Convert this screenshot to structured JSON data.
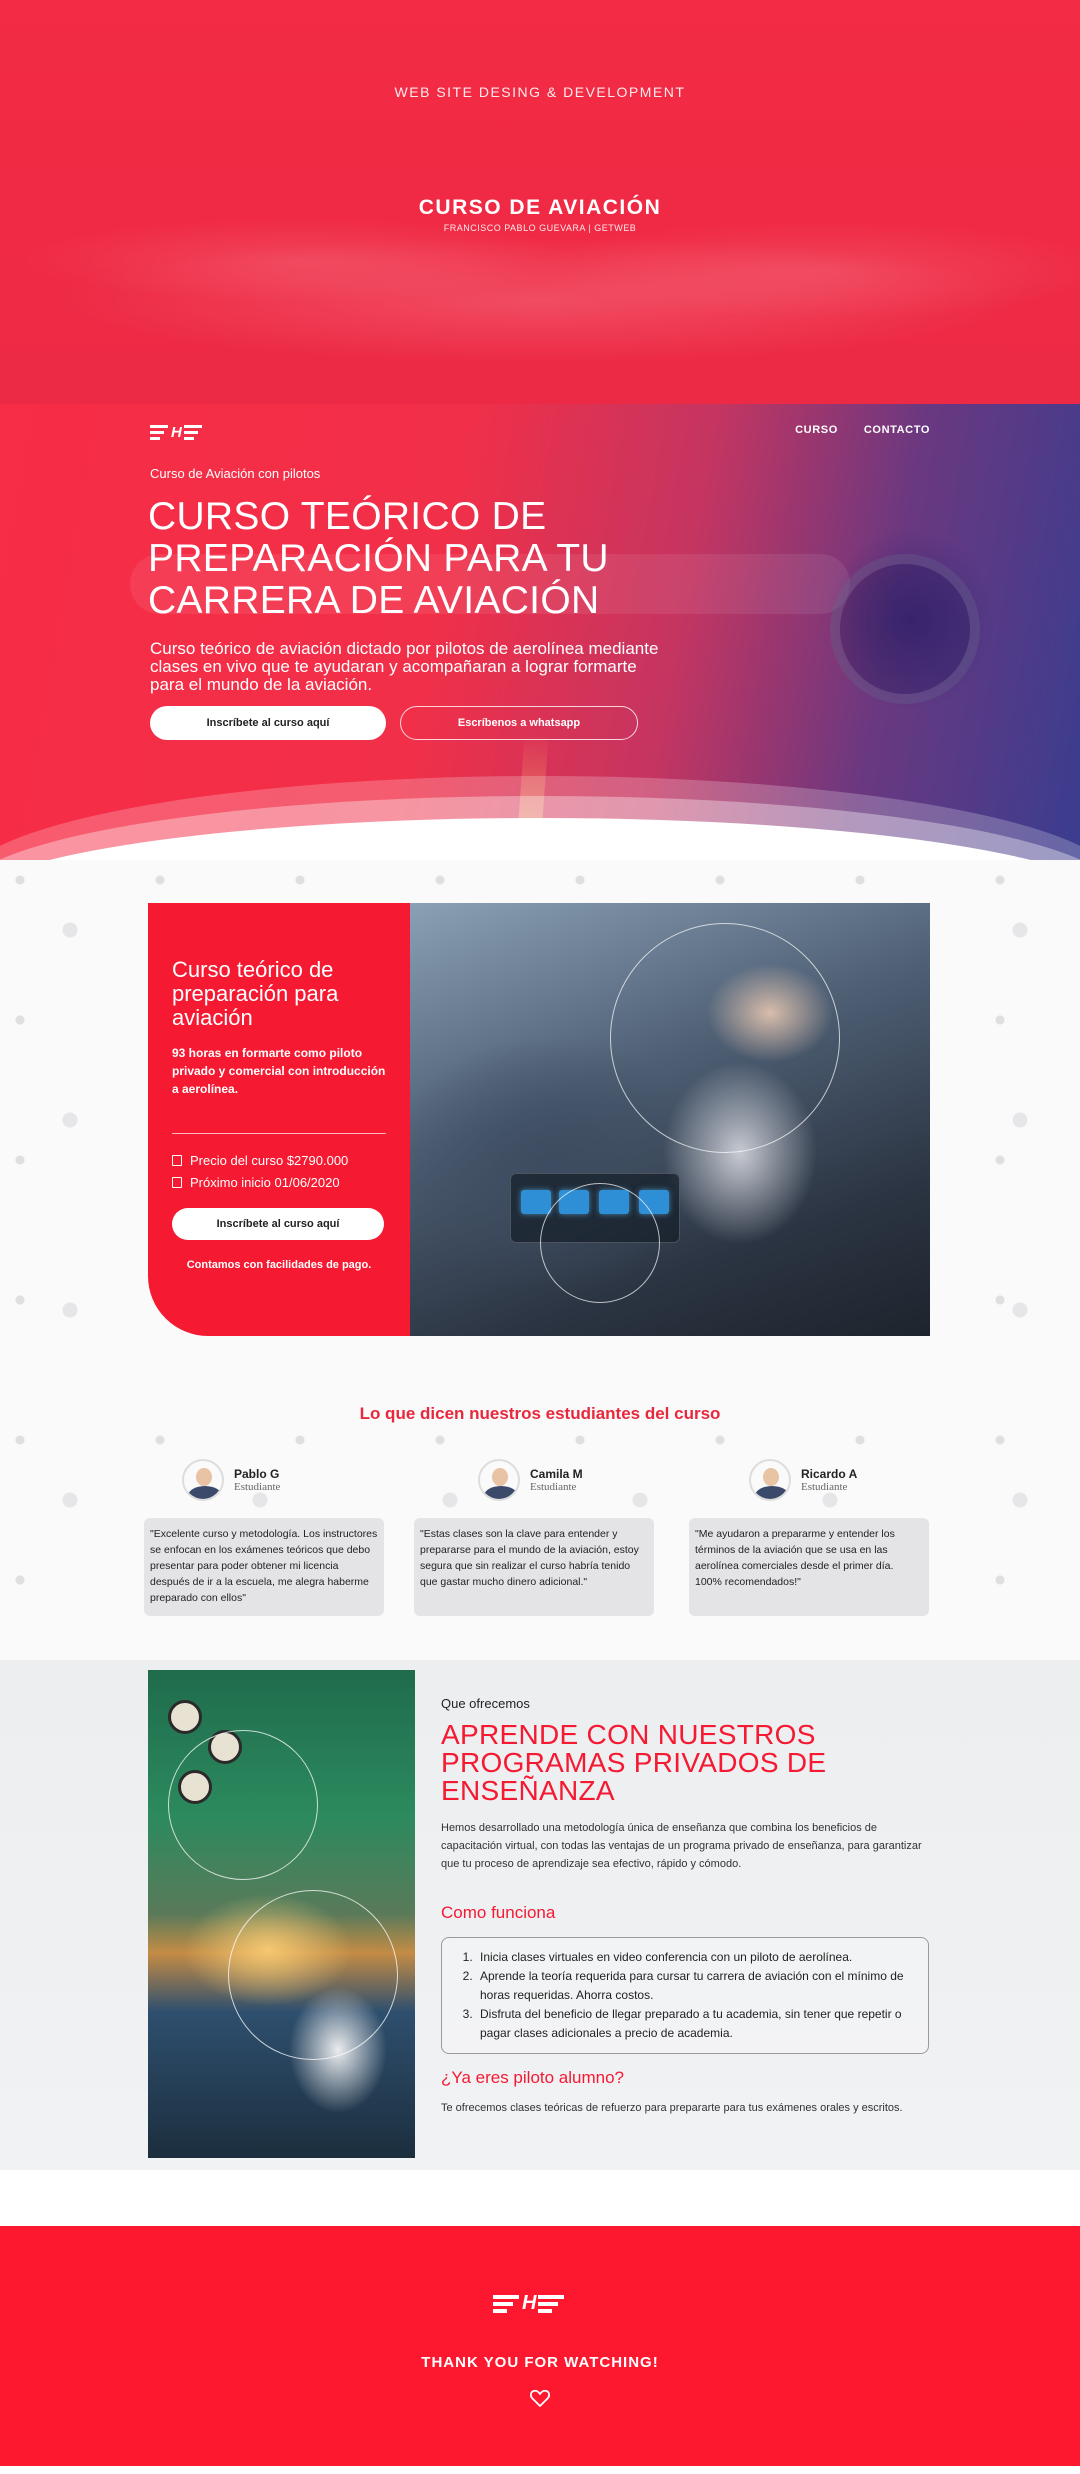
{
  "banner": {
    "kicker": "WEB SITE DESING & DEVELOPMENT",
    "title": "CURSO DE AVIACIÓN",
    "author": "FRANCISCO PABLO GUEVARA | GETWEB"
  },
  "nav": {
    "items": [
      {
        "label": "CURSO"
      },
      {
        "label": "CONTACTO"
      }
    ]
  },
  "hero": {
    "eyebrow": "Curso de Aviación con pilotos",
    "title": "CURSO TEÓRICO DE PREPARACIÓN PARA TU CARRERA DE AVIACIÓN",
    "lead": "Curso teórico de aviación dictado por pilotos de aerolínea mediante clases en vivo que te ayudaran y acompañaran a lograr formarte para el mundo de la aviación.",
    "primary_button": "Inscríbete al curso aquí",
    "secondary_button": "Escríbenos a whatsapp"
  },
  "course": {
    "title": "Curso teórico de preparación para aviación",
    "subtitle": "93 horas en formarte como piloto privado y comercial con introducción a aerolínea.",
    "price": "Precio del curso $2790.000",
    "start": "Próximo inicio 01/06/2020",
    "button": "Inscríbete al curso aquí",
    "payment_note": "Contamos con facilidades de pago."
  },
  "testimonials": {
    "title": "Lo que dicen nuestros estudiantes del curso",
    "items": [
      {
        "name": "Pablo G",
        "role": "Estudiante",
        "quote": "\"Excelente curso y metodología. Los instructores se enfocan en los exámenes teóricos que debo presentar para poder obtener mi licencia después de ir a la escuela, me alegra haberme preparado con ellos\""
      },
      {
        "name": "Camila M",
        "role": "Estudiante",
        "quote": "\"Estas clases son la clave para entender y prepararse para el mundo de la aviación, estoy segura que sin realizar el curso habría tenido que gastar mucho dinero adicional.\""
      },
      {
        "name": "Ricardo A",
        "role": "Estudiante",
        "quote": "\"Me ayudaron a prepararme y entender los términos de la aviación que se usa en las aerolínea comerciales desde el primer día. 100% recomendados!\""
      }
    ]
  },
  "offer": {
    "eyebrow": "Que ofrecemos",
    "title": "APRENDE CON NUESTROS PROGRAMAS PRIVADOS DE ENSEÑANZA",
    "description": "Hemos desarrollado una metodología única de enseñanza que combina los beneficios de capacitación virtual, con todas las ventajas de un programa privado de enseñanza, para garantizar que tu proceso de aprendizaje sea efectivo, rápido y cómodo.",
    "how_title": "Como funciona",
    "steps": [
      "Inicia clases virtuales en video conferencia con un piloto de aerolínea.",
      "Aprende la teoría requerida para cursar tu carrera de aviación con el mínimo de horas requeridas. Ahorra costos.",
      "Disfruta del beneficio de llegar preparado a tu academia, sin tener que repetir o pagar clases adicionales a precio de academia."
    ],
    "student_q": "¿Ya eres piloto alumno?",
    "student_text": "Te ofrecemos clases teóricas de refuerzo para prepararte para tus exámenes orales y escritos."
  },
  "footer": {
    "thanks": "THANK YOU FOR WATCHING!"
  },
  "colors": {
    "brand_red": "#f51932",
    "footer_red": "#fd1830",
    "hero_blue": "#3a3d8f"
  }
}
